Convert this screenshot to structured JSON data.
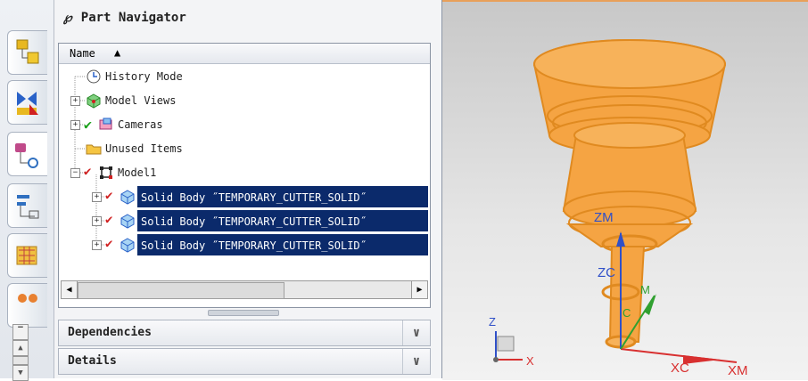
{
  "left_toolbar": {
    "tabs": [
      "assembly-navigator-icon",
      "constraint-navigator-icon",
      "part-navigator-icon",
      "reuse-library-icon",
      "history-icon",
      "roles-icon"
    ]
  },
  "navigator": {
    "title": "Part Navigator",
    "column_header": "Name",
    "sort_indicator": "▲",
    "items": [
      {
        "label": "History Mode",
        "icon": "clock-icon"
      },
      {
        "label": "Model Views",
        "icon": "model-views-icon"
      },
      {
        "label": "Cameras",
        "icon": "camera-icon"
      },
      {
        "label": "Unused Items",
        "icon": "folder-icon"
      },
      {
        "label": "Model1",
        "icon": "model-icon"
      },
      {
        "label": "Solid Body ˝TEMPORARY_CUTTER_SOLID˝",
        "icon": "solid-body-icon"
      },
      {
        "label": "Solid Body ˝TEMPORARY_CUTTER_SOLID˝",
        "icon": "solid-body-icon"
      },
      {
        "label": "Solid Body ˝TEMPORARY_CUTTER_SOLID˝",
        "icon": "solid-body-icon"
      }
    ],
    "sections": [
      "Dependencies",
      "Details"
    ]
  },
  "viewport": {
    "labels": {
      "zm": "ZM",
      "zc": "ZC",
      "ym": "M",
      "yc": "C",
      "xc": "XC",
      "xm": "XM",
      "z": "Z",
      "x": "X"
    },
    "colors": {
      "cutter": "#f5a443",
      "cutter_edge": "#e08a20",
      "axis_blue": "#3050c8",
      "axis_red": "#d83030",
      "axis_green": "#30a030"
    }
  }
}
